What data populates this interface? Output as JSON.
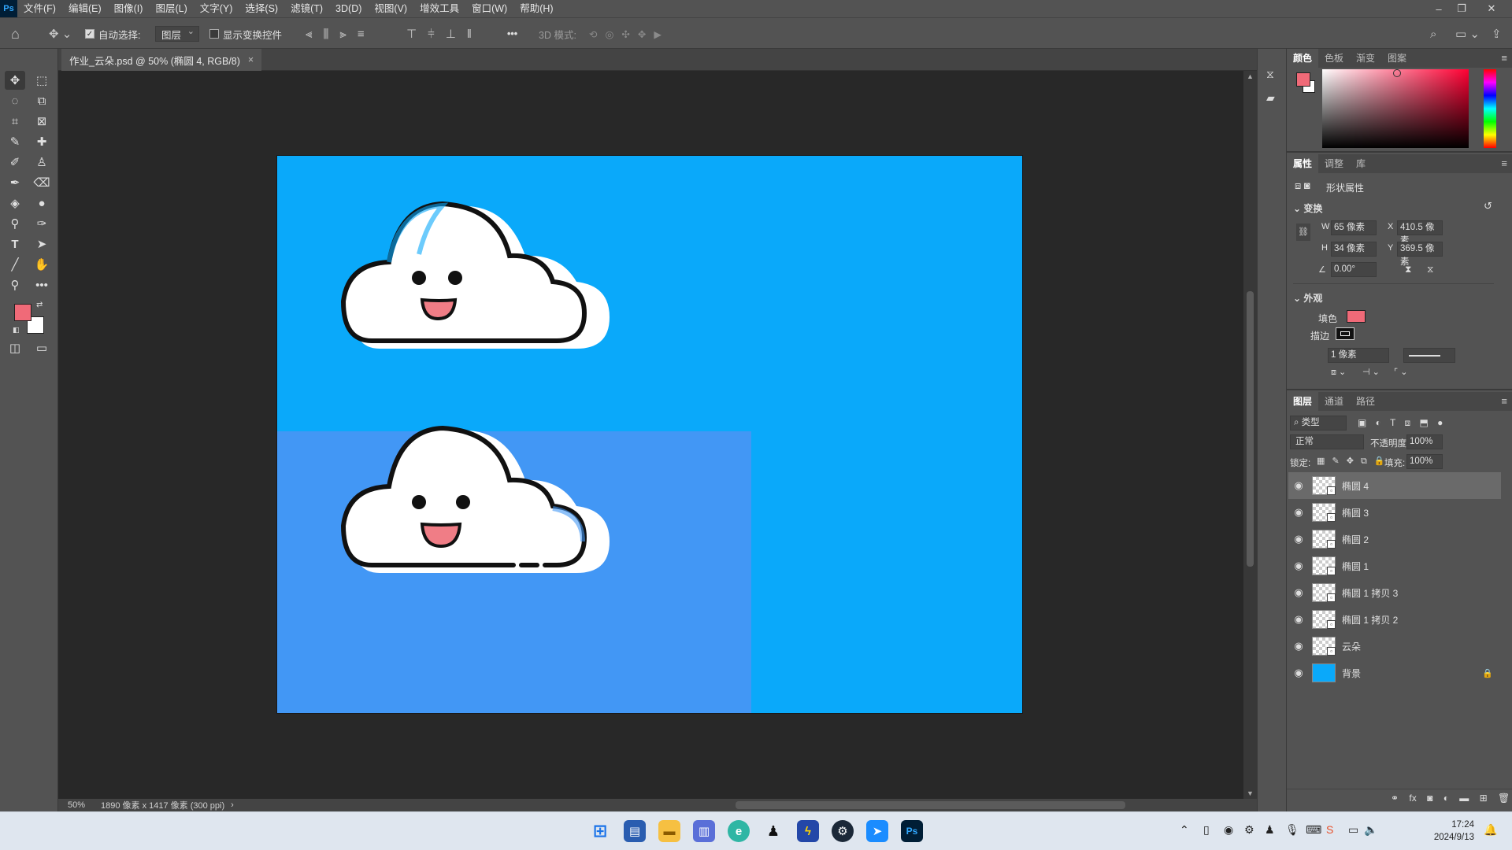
{
  "app": {
    "logo": "Ps"
  },
  "menu": [
    "文件(F)",
    "编辑(E)",
    "图像(I)",
    "图层(L)",
    "文字(Y)",
    "选择(S)",
    "滤镜(T)",
    "3D(D)",
    "视图(V)",
    "增效工具",
    "窗口(W)",
    "帮助(H)"
  ],
  "options": {
    "auto_select_label": "自动选择:",
    "auto_select_value": "图层",
    "show_transform_label": "显示变换控件",
    "mode_3d_label": "3D 模式:",
    "more": "•••"
  },
  "document": {
    "tab_title": "作业_云朵.psd @ 50% (椭圆 4, RGB/8)",
    "close": "×"
  },
  "status": {
    "zoom": "50%",
    "doc_size": "1890 像素 x 1417 像素 (300 ppi)",
    "arrow": "›"
  },
  "color_panel": {
    "tabs": [
      "颜色",
      "色板",
      "渐变",
      "图案"
    ],
    "foreground": "#f06a78",
    "background": "#ffffff"
  },
  "properties_panel": {
    "tabs": [
      "属性",
      "调整",
      "库"
    ],
    "shape_label": "形状属性",
    "transform_title": "变换",
    "w_label": "W",
    "w_value": "65 像素",
    "h_label": "H",
    "h_value": "34 像素",
    "x_label": "X",
    "x_value": "410.5 像素",
    "y_label": "Y",
    "y_value": "369.5 像素",
    "angle_value": "0.00°",
    "appearance_title": "外观",
    "fill_label": "填色",
    "fill_color": "#f06a78",
    "stroke_label": "描边",
    "stroke_width": "1 像素"
  },
  "layers_panel": {
    "tabs": [
      "图层",
      "通道",
      "路径"
    ],
    "filter_label": "类型",
    "blend_mode": "正常",
    "opacity_label": "不透明度:",
    "opacity_value": "100%",
    "lock_label": "锁定:",
    "fill_label": "填充:",
    "fill_value": "100%",
    "layers": [
      {
        "name": "椭圆 4",
        "selected": true
      },
      {
        "name": "椭圆 3",
        "selected": false
      },
      {
        "name": "椭圆 2",
        "selected": false
      },
      {
        "name": "椭圆 1",
        "selected": false
      },
      {
        "name": "椭圆 1 拷贝 3",
        "selected": false
      },
      {
        "name": "椭圆 1 拷贝 2",
        "selected": false
      },
      {
        "name": "云朵",
        "selected": false
      },
      {
        "name": "背景",
        "selected": false
      }
    ]
  },
  "canvas": {
    "background_color": "#0aa9fa",
    "lower_rect_color": "#4297f5",
    "cheek_color": "#f07d86"
  },
  "taskbar": {
    "time": "17:24",
    "date": "2024/9/13"
  }
}
